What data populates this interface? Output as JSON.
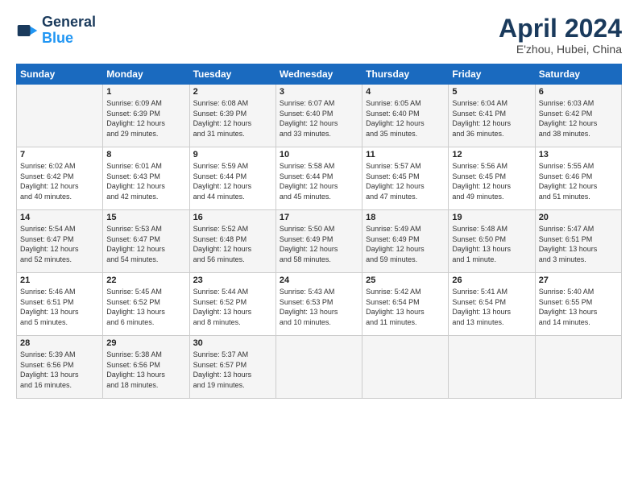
{
  "header": {
    "logo_line1": "General",
    "logo_line2": "Blue",
    "title": "April 2024",
    "location": "E'zhou, Hubei, China"
  },
  "weekdays": [
    "Sunday",
    "Monday",
    "Tuesday",
    "Wednesday",
    "Thursday",
    "Friday",
    "Saturday"
  ],
  "weeks": [
    [
      {
        "day": "",
        "info": ""
      },
      {
        "day": "1",
        "info": "Sunrise: 6:09 AM\nSunset: 6:39 PM\nDaylight: 12 hours\nand 29 minutes."
      },
      {
        "day": "2",
        "info": "Sunrise: 6:08 AM\nSunset: 6:39 PM\nDaylight: 12 hours\nand 31 minutes."
      },
      {
        "day": "3",
        "info": "Sunrise: 6:07 AM\nSunset: 6:40 PM\nDaylight: 12 hours\nand 33 minutes."
      },
      {
        "day": "4",
        "info": "Sunrise: 6:05 AM\nSunset: 6:40 PM\nDaylight: 12 hours\nand 35 minutes."
      },
      {
        "day": "5",
        "info": "Sunrise: 6:04 AM\nSunset: 6:41 PM\nDaylight: 12 hours\nand 36 minutes."
      },
      {
        "day": "6",
        "info": "Sunrise: 6:03 AM\nSunset: 6:42 PM\nDaylight: 12 hours\nand 38 minutes."
      }
    ],
    [
      {
        "day": "7",
        "info": "Sunrise: 6:02 AM\nSunset: 6:42 PM\nDaylight: 12 hours\nand 40 minutes."
      },
      {
        "day": "8",
        "info": "Sunrise: 6:01 AM\nSunset: 6:43 PM\nDaylight: 12 hours\nand 42 minutes."
      },
      {
        "day": "9",
        "info": "Sunrise: 5:59 AM\nSunset: 6:44 PM\nDaylight: 12 hours\nand 44 minutes."
      },
      {
        "day": "10",
        "info": "Sunrise: 5:58 AM\nSunset: 6:44 PM\nDaylight: 12 hours\nand 45 minutes."
      },
      {
        "day": "11",
        "info": "Sunrise: 5:57 AM\nSunset: 6:45 PM\nDaylight: 12 hours\nand 47 minutes."
      },
      {
        "day": "12",
        "info": "Sunrise: 5:56 AM\nSunset: 6:45 PM\nDaylight: 12 hours\nand 49 minutes."
      },
      {
        "day": "13",
        "info": "Sunrise: 5:55 AM\nSunset: 6:46 PM\nDaylight: 12 hours\nand 51 minutes."
      }
    ],
    [
      {
        "day": "14",
        "info": "Sunrise: 5:54 AM\nSunset: 6:47 PM\nDaylight: 12 hours\nand 52 minutes."
      },
      {
        "day": "15",
        "info": "Sunrise: 5:53 AM\nSunset: 6:47 PM\nDaylight: 12 hours\nand 54 minutes."
      },
      {
        "day": "16",
        "info": "Sunrise: 5:52 AM\nSunset: 6:48 PM\nDaylight: 12 hours\nand 56 minutes."
      },
      {
        "day": "17",
        "info": "Sunrise: 5:50 AM\nSunset: 6:49 PM\nDaylight: 12 hours\nand 58 minutes."
      },
      {
        "day": "18",
        "info": "Sunrise: 5:49 AM\nSunset: 6:49 PM\nDaylight: 12 hours\nand 59 minutes."
      },
      {
        "day": "19",
        "info": "Sunrise: 5:48 AM\nSunset: 6:50 PM\nDaylight: 13 hours\nand 1 minute."
      },
      {
        "day": "20",
        "info": "Sunrise: 5:47 AM\nSunset: 6:51 PM\nDaylight: 13 hours\nand 3 minutes."
      }
    ],
    [
      {
        "day": "21",
        "info": "Sunrise: 5:46 AM\nSunset: 6:51 PM\nDaylight: 13 hours\nand 5 minutes."
      },
      {
        "day": "22",
        "info": "Sunrise: 5:45 AM\nSunset: 6:52 PM\nDaylight: 13 hours\nand 6 minutes."
      },
      {
        "day": "23",
        "info": "Sunrise: 5:44 AM\nSunset: 6:52 PM\nDaylight: 13 hours\nand 8 minutes."
      },
      {
        "day": "24",
        "info": "Sunrise: 5:43 AM\nSunset: 6:53 PM\nDaylight: 13 hours\nand 10 minutes."
      },
      {
        "day": "25",
        "info": "Sunrise: 5:42 AM\nSunset: 6:54 PM\nDaylight: 13 hours\nand 11 minutes."
      },
      {
        "day": "26",
        "info": "Sunrise: 5:41 AM\nSunset: 6:54 PM\nDaylight: 13 hours\nand 13 minutes."
      },
      {
        "day": "27",
        "info": "Sunrise: 5:40 AM\nSunset: 6:55 PM\nDaylight: 13 hours\nand 14 minutes."
      }
    ],
    [
      {
        "day": "28",
        "info": "Sunrise: 5:39 AM\nSunset: 6:56 PM\nDaylight: 13 hours\nand 16 minutes."
      },
      {
        "day": "29",
        "info": "Sunrise: 5:38 AM\nSunset: 6:56 PM\nDaylight: 13 hours\nand 18 minutes."
      },
      {
        "day": "30",
        "info": "Sunrise: 5:37 AM\nSunset: 6:57 PM\nDaylight: 13 hours\nand 19 minutes."
      },
      {
        "day": "",
        "info": ""
      },
      {
        "day": "",
        "info": ""
      },
      {
        "day": "",
        "info": ""
      },
      {
        "day": "",
        "info": ""
      }
    ]
  ]
}
